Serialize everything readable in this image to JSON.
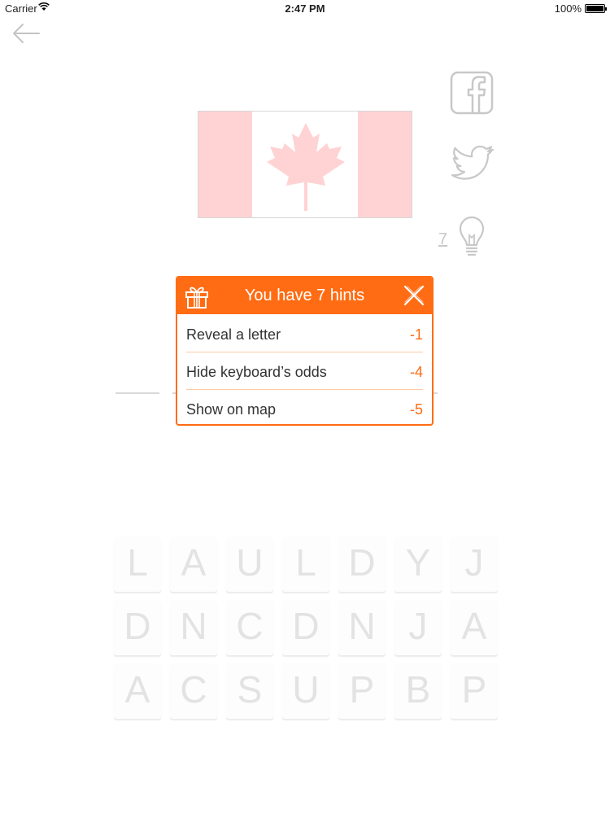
{
  "status_bar": {
    "carrier": "Carrier",
    "time": "2:47 PM",
    "battery": "100%"
  },
  "question": {
    "flag": "canada-flag-icon"
  },
  "social": {
    "facebook": "facebook-icon",
    "twitter": "twitter-icon"
  },
  "hints": {
    "count": "7"
  },
  "popup": {
    "title": "You have 7 hints",
    "options": [
      {
        "label": "Reveal a letter",
        "cost": "-1"
      },
      {
        "label": "Hide keyboard’s odds",
        "cost": "-4"
      },
      {
        "label": "Show on map",
        "cost": "-5"
      }
    ]
  },
  "keyboard": {
    "rows": [
      [
        "L",
        "A",
        "U",
        "L",
        "D",
        "Y",
        "J"
      ],
      [
        "D",
        "N",
        "C",
        "D",
        "N",
        "J",
        "A"
      ],
      [
        "A",
        "C",
        "S",
        "U",
        "P",
        "B",
        "P"
      ]
    ]
  },
  "colors": {
    "accent": "#ff6c13",
    "flag_red": "#ffd3d3",
    "muted": "#c8c8c8"
  }
}
